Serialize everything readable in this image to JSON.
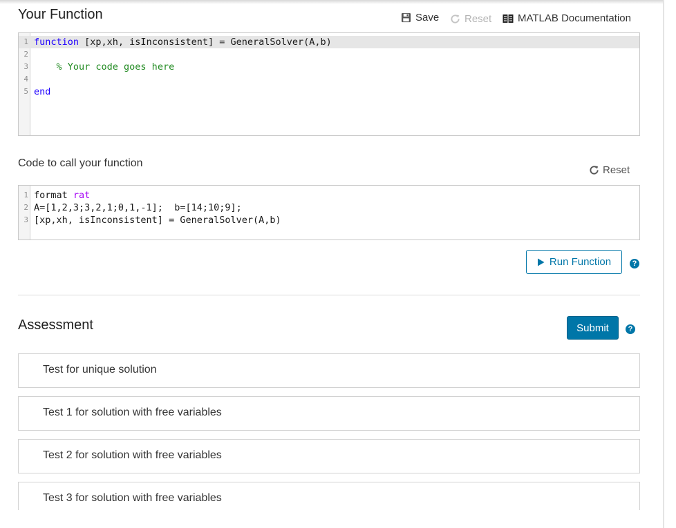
{
  "function_section": {
    "title": "Your Function",
    "save_label": "Save",
    "reset_label": "Reset",
    "docs_label": "MATLAB Documentation",
    "code_lines": [
      {
        "n": "1",
        "tokens": [
          {
            "t": "function",
            "c": "kw"
          },
          {
            "t": " [xp,xh, isInconsistent] = GeneralSolver(A,b)",
            "c": ""
          }
        ]
      },
      {
        "n": "2",
        "tokens": []
      },
      {
        "n": "3",
        "tokens": [
          {
            "t": "    ",
            "c": ""
          },
          {
            "t": "% Your code goes here",
            "c": "cm"
          }
        ]
      },
      {
        "n": "4",
        "tokens": []
      },
      {
        "n": "5",
        "tokens": [
          {
            "t": "end",
            "c": "kw"
          }
        ]
      }
    ]
  },
  "call_section": {
    "title": "Code to call your function",
    "reset_label": "Reset",
    "code_lines": [
      {
        "n": "1",
        "tokens": [
          {
            "t": "format ",
            "c": ""
          },
          {
            "t": "rat",
            "c": "str"
          }
        ]
      },
      {
        "n": "2",
        "tokens": [
          {
            "t": "A=[1,2,3;3,2,1;0,1,-1];  b=[14;10;9];",
            "c": ""
          }
        ]
      },
      {
        "n": "3",
        "tokens": [
          {
            "t": "[xp,xh, isInconsistent] = GeneralSolver(A,b)",
            "c": ""
          }
        ]
      }
    ],
    "run_label": "Run Function",
    "help_glyph": "?"
  },
  "assessment": {
    "title": "Assessment",
    "submit_label": "Submit",
    "help_glyph": "?",
    "tests": [
      "Test for unique solution",
      "Test 1 for solution with free variables",
      "Test 2 for solution with free variables",
      "Test 3 for solution with free variables"
    ]
  },
  "colors": {
    "accent": "#0076a8",
    "keyword": "#1f00ff",
    "comment": "#228b22",
    "string": "#a709f5"
  }
}
